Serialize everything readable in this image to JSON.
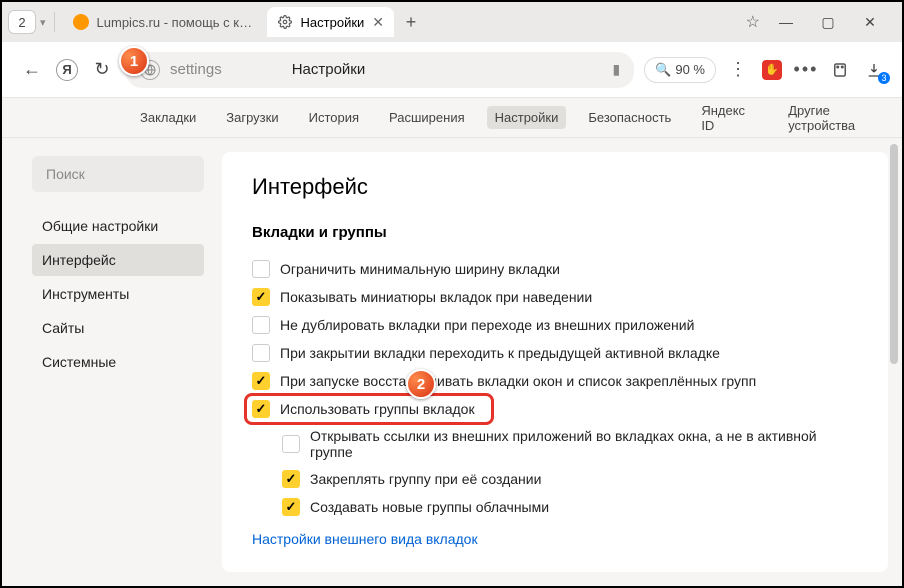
{
  "tabstrip": {
    "counter": "2",
    "tabs": [
      {
        "title": "Lumpics.ru - помощь с ком",
        "active": false
      },
      {
        "title": "Настройки",
        "active": true
      }
    ]
  },
  "toolbar": {
    "addr_path": "settings",
    "addr_title": "Настройки",
    "zoom": "90 %"
  },
  "navrow": {
    "items": [
      "Закладки",
      "Загрузки",
      "История",
      "Расширения",
      "Настройки",
      "Безопасность",
      "Яндекс ID",
      "Другие устройства"
    ],
    "active_index": 4
  },
  "sidebar": {
    "search_placeholder": "Поиск",
    "items": [
      "Общие настройки",
      "Интерфейс",
      "Инструменты",
      "Сайты",
      "Системные"
    ],
    "active_index": 1
  },
  "content": {
    "heading": "Интерфейс",
    "section": "Вкладки и группы",
    "options": [
      {
        "label": "Ограничить минимальную ширину вкладки",
        "checked": false,
        "sub": false
      },
      {
        "label": "Показывать миниатюры вкладок при наведении",
        "checked": true,
        "sub": false
      },
      {
        "label": "Не дублировать вкладки при переходе из внешних приложений",
        "checked": false,
        "sub": false
      },
      {
        "label": "При закрытии вкладки переходить к предыдущей активной вкладке",
        "checked": false,
        "sub": false
      },
      {
        "label": "При запуске восстанавливать вкладки окон и список закреплённых групп",
        "checked": true,
        "sub": false,
        "hidden_part": true
      },
      {
        "label": "Использовать группы вкладок",
        "checked": true,
        "sub": false,
        "highlighted": true
      },
      {
        "label": "Открывать ссылки из внешних приложений во вкладках окна, а не в активной группе",
        "checked": false,
        "sub": true
      },
      {
        "label": "Закреплять группу при её создании",
        "checked": true,
        "sub": true
      },
      {
        "label": "Создавать новые группы облачными",
        "checked": true,
        "sub": true
      }
    ],
    "link": "Настройки внешнего вида вкладок"
  },
  "callouts": {
    "b1": "1",
    "b2": "2"
  }
}
